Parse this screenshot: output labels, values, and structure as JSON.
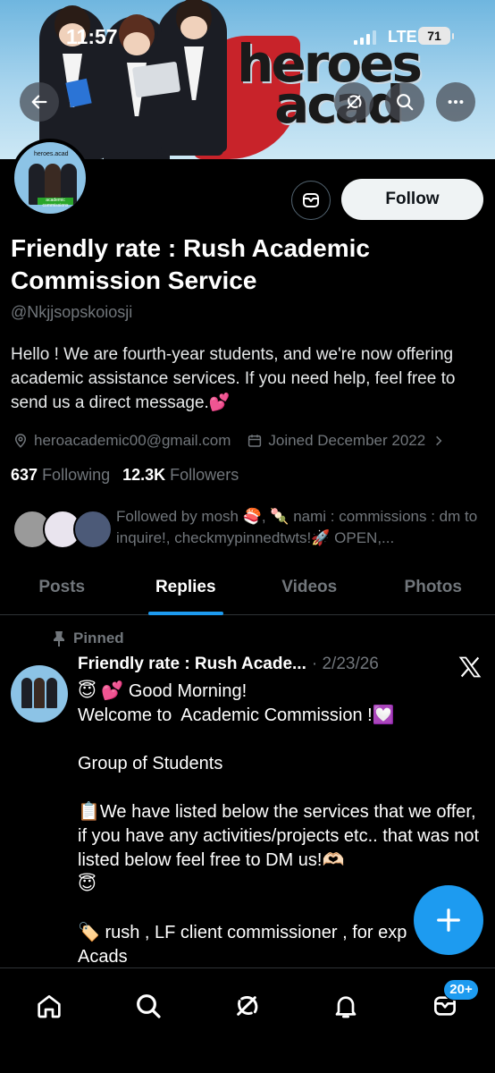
{
  "status_bar": {
    "time": "11:57",
    "network": "LTE",
    "battery": "71"
  },
  "banner": {
    "brand_line1": "heroes",
    "brand_line2": "acad"
  },
  "header_actions": {
    "back": "arrow-left-icon",
    "grok": "grok-icon",
    "search": "search-icon",
    "more": "more-icon"
  },
  "profile": {
    "avatar_text": "heroes.acad",
    "avatar_label": "academic commissions",
    "follow_label": "Follow",
    "name": "Friendly rate : Rush Academic Commission Service",
    "handle": "@Nkjjsopskoiosji",
    "bio": "Hello ! We are fourth-year students, and we're now offering academic assistance services. If you need help, feel free to send us a direct message.💕",
    "email": "heroacademic00@gmail.com",
    "joined": "Joined December 2022",
    "following_count": "637",
    "following_label": "Following",
    "followers_count": "12.3K",
    "followers_label": "Followers",
    "followed_by": "Followed by mosh 🍣, 🍡 nami : commissions : dm to inquire!, checkmypinnedtwts!🚀 OPEN,..."
  },
  "tabs": [
    "Posts",
    "Replies",
    "Videos",
    "Photos"
  ],
  "active_tab": "Replies",
  "post": {
    "pinned_label": "Pinned",
    "author": "Friendly rate : Rush Acade...",
    "date": "· 2/23/26",
    "body": "😇 💕 Good Morning!\nWelcome to  Academic Commission !💟\n\nGroup of Students\n\n📋We have listed below the services that we offer, if you have any activities/projects etc.. that was not listed below feel free to DM us!🫶🏻\n😇\n\n🏷️ rush , LF client commissioner , for exp\nAcads"
  },
  "bottom_nav": {
    "messages_badge": "20+"
  },
  "colors": {
    "accent": "#1d9bf0",
    "background": "#000000",
    "secondary_text": "#71767b"
  }
}
